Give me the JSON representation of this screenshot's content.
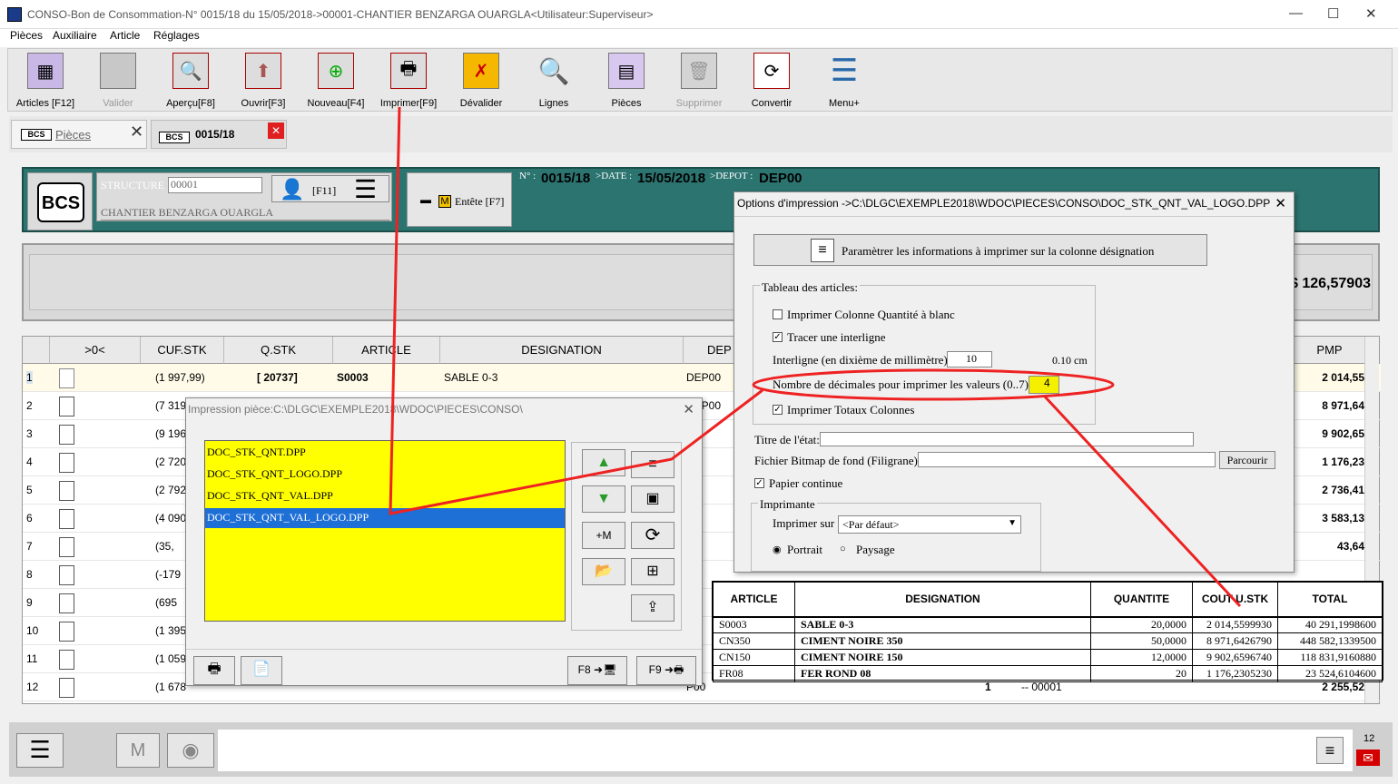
{
  "window": {
    "title": "CONSO-Bon de Consommation-N° 0015/18 du 15/05/2018->00001-CHANTIER BENZARGA OUARGLA<Utilisateur:Superviseur>",
    "minimize": "—",
    "maximize": "☐",
    "close": "✕"
  },
  "menu": [
    "Pièces",
    "Auxiliaire",
    "Article",
    "Réglages"
  ],
  "toolbar": [
    {
      "label": "Articles [F12]",
      "icon": "grid-icon",
      "glyph": "▦",
      "enabled": true
    },
    {
      "label": "Valider",
      "icon": "validate-icon",
      "glyph": "",
      "enabled": false
    },
    {
      "label": "Aperçu[F8]",
      "icon": "preview-icon",
      "glyph": "🔍",
      "enabled": true
    },
    {
      "label": "Ouvrir[F3]",
      "icon": "open-icon",
      "glyph": "⬆",
      "enabled": true
    },
    {
      "label": "Nouveau[F4]",
      "icon": "new-icon",
      "glyph": "⊕",
      "enabled": true
    },
    {
      "label": "Imprimer[F9]",
      "icon": "printer-icon",
      "glyph": "🖶",
      "enabled": true
    },
    {
      "label": "Dévalider",
      "icon": "unvalidate-icon",
      "glyph": "✗",
      "enabled": true
    },
    {
      "label": "Lignes",
      "icon": "magnifier-icon",
      "glyph": "🔍",
      "enabled": true
    },
    {
      "label": "Pièces",
      "icon": "pieces-icon",
      "glyph": "▤",
      "enabled": true
    },
    {
      "label": "Supprimer",
      "icon": "trash-icon",
      "glyph": "🗑",
      "enabled": false
    },
    {
      "label": "Convertir",
      "icon": "convert-icon",
      "glyph": "⟳",
      "enabled": true
    },
    {
      "label": "Menu+",
      "icon": "menu-lines-icon",
      "glyph": "☰",
      "enabled": true
    }
  ],
  "tabs": {
    "pieces": {
      "label": "Pièces",
      "badge": "BCS",
      "close": "✕"
    },
    "doc": {
      "label": "0015/18",
      "badge": "BCS",
      "close": "✕"
    }
  },
  "header": {
    "badge": "BCS",
    "structure_label": "STRUCTURE",
    "structure_code": "00001",
    "structure_name": "CHANTIER BENZARGA OUARGLA",
    "f11": "[F11]",
    "entete": "Entête [F7]",
    "entete_m": "M",
    "no_label": "N° :",
    "no_value": "0015/18",
    "date_label": ">DATE :",
    "date_value": "15/05/2018",
    "depot_label": ">DEPOT :",
    "depot_value": "DEP00"
  },
  "total_display": "$ 126,57903",
  "grid": {
    "headers": {
      "mark": ">0<",
      "cuf": "CUF.STK",
      "qstk": "Q.STK",
      "article": "ARTICLE",
      "designation": "DESIGNATION",
      "depot": "DEP",
      "pmp": "PMP"
    },
    "rows": [
      {
        "n": "1",
        "cuf": "(1 997,99)",
        "q": "[ 20737]",
        "art": "S0003",
        "des": "SABLE 0-3",
        "dep": "DEP00",
        "pmp": "2 014,55"
      },
      {
        "n": "2",
        "cuf": "(7 319",
        "q": "",
        "art": "",
        "des": "",
        "dep": "DEP00",
        "pmp": "8 971,64"
      },
      {
        "n": "3",
        "cuf": "(9 196",
        "q": "",
        "art": "",
        "des": "",
        "dep": "",
        "pmp": "9 902,65"
      },
      {
        "n": "4",
        "cuf": "(2 720",
        "q": "",
        "art": "",
        "des": "",
        "dep": "",
        "pmp": "1 176,23"
      },
      {
        "n": "5",
        "cuf": "(2 792",
        "q": "",
        "art": "",
        "des": "",
        "dep": "",
        "pmp": "2 736,41"
      },
      {
        "n": "6",
        "cuf": "(4 090",
        "q": "",
        "art": "",
        "des": "",
        "dep": "",
        "pmp": "3 583,13"
      },
      {
        "n": "7",
        "cuf": "(35,",
        "q": "",
        "art": "",
        "des": "",
        "dep": "",
        "pmp": "43,64"
      },
      {
        "n": "8",
        "cuf": "(-179",
        "q": "",
        "art": "",
        "des": "",
        "dep": "",
        "pmp": ""
      },
      {
        "n": "9",
        "cuf": "(695",
        "q": "",
        "art": "",
        "des": "",
        "dep": "",
        "pmp": ""
      },
      {
        "n": "10",
        "cuf": "(1 395",
        "q": "",
        "art": "",
        "des": "",
        "dep": "",
        "pmp": ""
      },
      {
        "n": "11",
        "cuf": "(1 059",
        "q": "",
        "art": "",
        "des": "",
        "dep": "",
        "pmp": ""
      },
      {
        "n": "12",
        "cuf": "(1 678",
        "q": "",
        "art": "",
        "des": "",
        "dep": "P00",
        "pmp": "2 255,52"
      }
    ],
    "row12_extra1": "1",
    "row12_extra2": "-- 00001"
  },
  "bottom": {
    "m_label": "M",
    "counter": "12"
  },
  "dlg1": {
    "title": "Impression pièce:C:\\DLGC\\EXEMPLE2018\\WDOC\\PIECES\\CONSO\\",
    "close": "✕",
    "files": [
      "DOC_STK_QNT.DPP",
      "DOC_STK_QNT_LOGO.DPP",
      "DOC_STK_QNT_VAL.DPP",
      "DOC_STK_QNT_VAL_LOGO.DPP"
    ],
    "plus_m": "+M",
    "f8": "F8",
    "f9": "F9"
  },
  "dlg2": {
    "title": "Options d'impression ->C:\\DLGC\\EXEMPLE2018\\WDOC\\PIECES\\CONSO\\DOC_STK_QNT_VAL_LOGO.DPP",
    "close": "✕",
    "param_btn": "Paramètrer les informations à imprimer sur la colonne désignation",
    "group_label": "Tableau des articles:",
    "cb_qty": "Imprimer Colonne Quantité à blanc",
    "cb_interligne": "Tracer une interligne",
    "interligne_label": "Interligne (en dixième de millimètre) :",
    "interligne_value": "10",
    "interligne_cm": "0.10 cm",
    "decimals_label": "Nombre de décimales pour imprimer les valeurs (0..7):",
    "decimals_value": "4",
    "cb_totaux": "Imprimer Totaux Colonnes",
    "titre_label": "Titre de l'état:",
    "bitmap_label": "Fichier Bitmap de fond (Filigrane):",
    "parcourir": "Parcourir",
    "cb_papier": "Papier continue",
    "imprimante_group": "Imprimante",
    "imprimer_sur": "Imprimer sur :",
    "printer_value": "<Par défaut>",
    "portrait": "Portrait",
    "paysage": "Paysage"
  },
  "preview": {
    "headers": [
      "ARTICLE",
      "DESIGNATION",
      "QUANTITE",
      "COUT U.STK",
      "TOTAL"
    ],
    "rows": [
      [
        "S0003",
        "SABLE 0-3",
        "20,0000",
        "2 014,5599930",
        "40 291,1998600"
      ],
      [
        "CN350",
        "CIMENT NOIRE 350",
        "50,0000",
        "8 971,6426790",
        "448 582,1339500"
      ],
      [
        "CN150",
        "CIMENT NOIRE 150",
        "12,0000",
        "9 902,6596740",
        "118 831,9160880"
      ],
      [
        "FR08",
        "FER ROND 08",
        "20",
        "1 176,2305230",
        "23 524,6104600"
      ]
    ]
  }
}
